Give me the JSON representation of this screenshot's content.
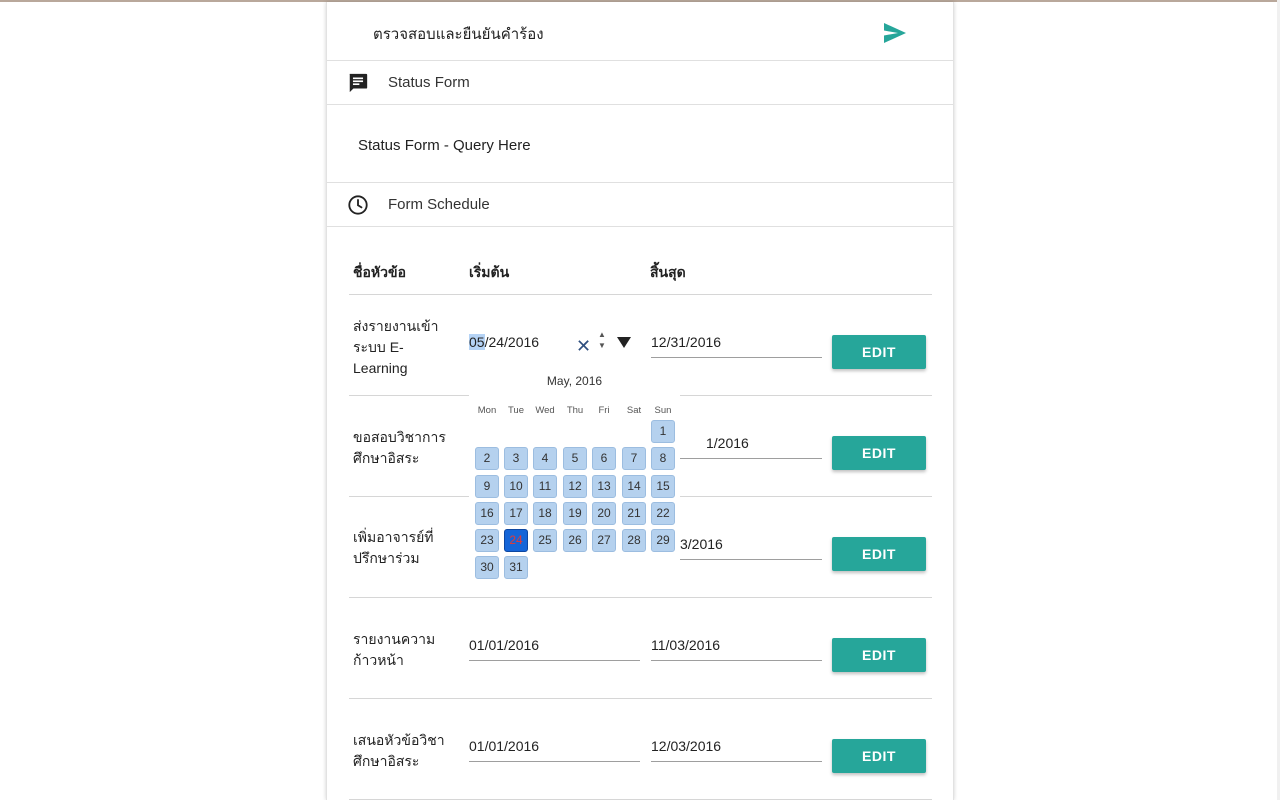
{
  "submit_section": {
    "text": "ตรวจสอบและยืนยันคำร้อง",
    "icon": "send-icon"
  },
  "status_form": {
    "header": "Status Form",
    "icon": "message-icon",
    "query_text": "Status Form - Query Here"
  },
  "schedule": {
    "header": "Form Schedule",
    "icon": "clock-icon",
    "columns": [
      "ชื่อหัวข้อ",
      "เริ่มต้น",
      "สิ้นสุด"
    ],
    "rows": [
      {
        "name_lines": [
          "ส่งรายงานเข้า",
          "ระบบ E-",
          "Learning"
        ],
        "start": "05/24/2016",
        "end": "12/31/2016",
        "edit": "EDIT"
      },
      {
        "name_lines": [
          "ขอสอบวิชาการ",
          "ศึกษาอิสระ"
        ],
        "start": "",
        "end": "1/2016",
        "edit": "EDIT"
      },
      {
        "name_lines": [
          "เพิ่มอาจารย์ที่",
          "ปรึกษาร่วม"
        ],
        "start": "",
        "end": "3/2016",
        "edit": "EDIT"
      },
      {
        "name_lines": [
          "รายงานความ",
          "ก้าวหน้า"
        ],
        "start": "01/01/2016",
        "end": "11/03/2016",
        "edit": "EDIT"
      },
      {
        "name_lines": [
          "เสนอหัวข้อวิชา",
          "ศึกษาอิสระ"
        ],
        "start": "01/01/2016",
        "end": "12/03/2016",
        "edit": "EDIT"
      }
    ]
  },
  "datepicker": {
    "month_label": "May, 2016",
    "weekdays": [
      "Mon",
      "Tue",
      "Wed",
      "Thu",
      "Fri",
      "Sat",
      "Sun"
    ],
    "days": [
      "1",
      "2",
      "3",
      "4",
      "5",
      "6",
      "7",
      "8",
      "9",
      "10",
      "11",
      "12",
      "13",
      "14",
      "15",
      "16",
      "17",
      "18",
      "19",
      "20",
      "21",
      "22",
      "23",
      "24",
      "25",
      "26",
      "27",
      "28",
      "29",
      "30",
      "31"
    ],
    "selected_day": "24",
    "selected_month_segment": "05",
    "rest_of_value": "/24/2016",
    "clear_glyph": "✕",
    "spin_up": "▲",
    "spin_down": "▼"
  },
  "colors": {
    "accent": "#26a69a",
    "selected_day": "#1565d8",
    "day_cell": "#b5d1ee"
  }
}
